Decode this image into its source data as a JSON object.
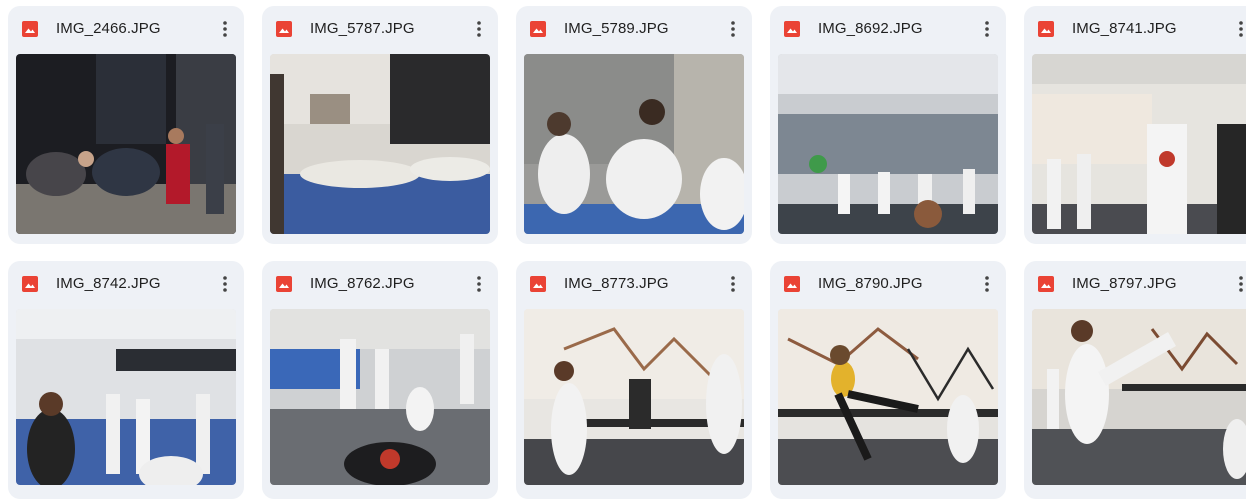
{
  "files": [
    {
      "name": "IMG_2466.JPG",
      "type_icon": "image-icon",
      "menu_icon": "more-vert-icon"
    },
    {
      "name": "IMG_5787.JPG",
      "type_icon": "image-icon",
      "menu_icon": "more-vert-icon"
    },
    {
      "name": "IMG_5789.JPG",
      "type_icon": "image-icon",
      "menu_icon": "more-vert-icon"
    },
    {
      "name": "IMG_8692.JPG",
      "type_icon": "image-icon",
      "menu_icon": "more-vert-icon"
    },
    {
      "name": "IMG_8741.JPG",
      "type_icon": "image-icon",
      "menu_icon": "more-vert-icon"
    },
    {
      "name": "IMG_8742.JPG",
      "type_icon": "image-icon",
      "menu_icon": "more-vert-icon"
    },
    {
      "name": "IMG_8762.JPG",
      "type_icon": "image-icon",
      "menu_icon": "more-vert-icon"
    },
    {
      "name": "IMG_8773.JPG",
      "type_icon": "image-icon",
      "menu_icon": "more-vert-icon"
    },
    {
      "name": "IMG_8790.JPG",
      "type_icon": "image-icon",
      "menu_icon": "more-vert-icon"
    },
    {
      "name": "IMG_8797.JPG",
      "type_icon": "image-icon",
      "menu_icon": "more-vert-icon"
    }
  ],
  "colors": {
    "card_bg": "#eef1f6",
    "image_icon": "#ea4335",
    "text": "#1f1f1f"
  }
}
